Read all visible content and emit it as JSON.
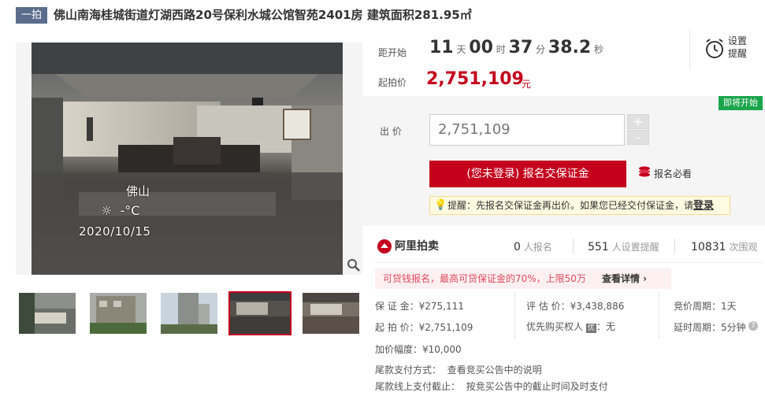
{
  "header": {
    "tag": "一拍",
    "title": "佛山南海桂城街道灯湖西路20号保利水城公馆智苑2401房 建筑面积281.95㎡"
  },
  "gallery": {
    "watermark_city": "佛山",
    "watermark_temp": "-°C",
    "watermark_date": "2020/10/15",
    "thumb_count": 5,
    "selected_thumb_index": 3
  },
  "countdown": {
    "label": "距开始",
    "days": "11",
    "days_unit": "天",
    "hours": "00",
    "hours_unit": "时",
    "minutes": "37",
    "minutes_unit": "分",
    "seconds": "38.2",
    "seconds_unit": "秒"
  },
  "reminder": {
    "line1": "设置",
    "line2": "提醒"
  },
  "start_price": {
    "label": "起拍价",
    "value": "2,751,109",
    "unit": "元"
  },
  "bid": {
    "status_badge": "即将开始",
    "label": "出 价",
    "value": "2,751,109",
    "plus": "+",
    "minus": "-",
    "cta": "(您未登录) 报名交保证金",
    "must_read": "报名必看",
    "tip_prefix": "提醒：先报名交保证金再出价。如果您已经交付保证金，请",
    "tip_link": "登录"
  },
  "stats": {
    "brand": "阿里拍卖",
    "signups": "0",
    "signups_label": "人报名",
    "reminders": "551",
    "reminders_label": "人设置提醒",
    "views": "10831",
    "views_label": "次围观"
  },
  "promo": {
    "text": "可贷钱报名，最高可贷保证金的70%，上限50万",
    "link": "查看详情"
  },
  "details": {
    "deposit": "保 证 金：¥275,111",
    "appraisal": "评 估 价：¥3,438,886",
    "cycle": "竞价周期：1天",
    "start": "起 拍 价：¥2,751,109",
    "priority_label": "优先购买权人",
    "priority_badge": "优",
    "priority_value": "：无",
    "delay": "延时周期：5分钟",
    "increment": "加价幅度：¥10,000",
    "tail_pay_label": "尾款支付方式：",
    "tail_pay_value": "查看竞买公告中的说明",
    "tail_deadline_label": "尾款线上支付截止：",
    "tail_deadline_value": "按竞买公告中的截止时间及时支付"
  }
}
